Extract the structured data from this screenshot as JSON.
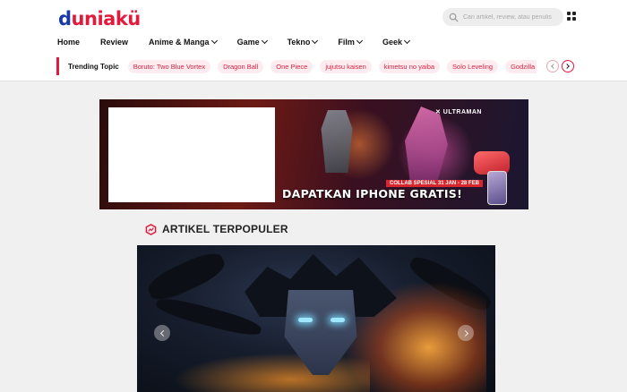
{
  "header": {
    "logo_first": "d",
    "logo_rest": "uniakü",
    "search_placeholder": "Cari artikel, review, atau penulis",
    "colors": {
      "brand_red": "#e21b3c",
      "brand_blue": "#1b3aa8"
    }
  },
  "nav": {
    "items": [
      {
        "label": "Home",
        "dropdown": false
      },
      {
        "label": "Review",
        "dropdown": false
      },
      {
        "label": "Anime & Manga",
        "dropdown": true
      },
      {
        "label": "Game",
        "dropdown": true
      },
      {
        "label": "Tekno",
        "dropdown": true
      },
      {
        "label": "Film",
        "dropdown": true
      },
      {
        "label": "Geek",
        "dropdown": true
      }
    ]
  },
  "trending": {
    "title": "Trending Topic",
    "tags": [
      "Boruto: Two Blue Vortex",
      "Dragon Ball",
      "One Piece",
      "jujutsu kaisen",
      "kimetsu no yaiba",
      "Solo Leveling",
      "Godzilla x Kong"
    ]
  },
  "banner": {
    "logos": "✕ ULTRAMAN",
    "promo_sub": "COLLAB SPESIAL 31 JAN - 28 FEB",
    "promo_main": "DAPATKAN IPHONE GRATIS!"
  },
  "section": {
    "title": "ARTIKEL TERPOPULER"
  }
}
